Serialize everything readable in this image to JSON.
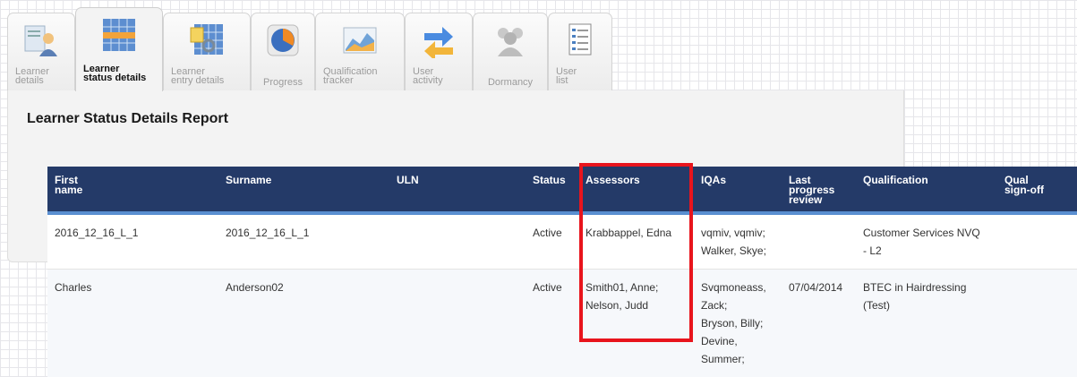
{
  "tabs": [
    {
      "label": "Learner\ndetails",
      "icon": "learner-icon",
      "active": false
    },
    {
      "label": "Learner\nstatus details",
      "icon": "status-icon",
      "active": true
    },
    {
      "label": "Learner\nentry details",
      "icon": "entry-icon",
      "active": false
    },
    {
      "label": "Progress",
      "icon": "progress-pie-icon",
      "active": false
    },
    {
      "label": "Qualification\ntracker",
      "icon": "area-chart-icon",
      "active": false
    },
    {
      "label": "User\nactivity",
      "icon": "arrows-icon",
      "active": false
    },
    {
      "label": "Dormancy",
      "icon": "people-icon",
      "active": false
    },
    {
      "label": "User\nlist",
      "icon": "list-icon",
      "active": false
    }
  ],
  "report": {
    "title": "Learner Status Details Report"
  },
  "table": {
    "headers": {
      "first_name": "First\nname",
      "surname": "Surname",
      "uln": "ULN",
      "status": "Status",
      "assessors": "Assessors",
      "iqas": "IQAs",
      "last_review": "Last\nprogress\nreview",
      "qualification": "Qualification",
      "qual_signoff": "Qual\nsign-off"
    },
    "rows": [
      {
        "first_name": "2016_12_16_L_1",
        "surname": "2016_12_16_L_1",
        "uln": "",
        "status": "Active",
        "assessors": "Krabbappel, Edna",
        "iqas": "vqmiv, vqmiv;\nWalker, Skye;",
        "last_review": "",
        "qualification": "Customer Services NVQ\n- L2",
        "qual_signoff": ""
      },
      {
        "first_name": "Charles",
        "surname": "Anderson02",
        "uln": "",
        "status": "Active",
        "assessors": "Smith01, Anne;\nNelson, Judd",
        "iqas": "Svqmoneass,\nZack;\nBryson, Billy;\nDevine,\nSummer;",
        "last_review": "07/04/2014",
        "qualification": "BTEC in Hairdressing\n(Test)",
        "qual_signoff": ""
      }
    ]
  },
  "colors": {
    "header_bg": "#243a68",
    "header_accent": "#5a8fd1",
    "highlight": "#e8141c"
  }
}
